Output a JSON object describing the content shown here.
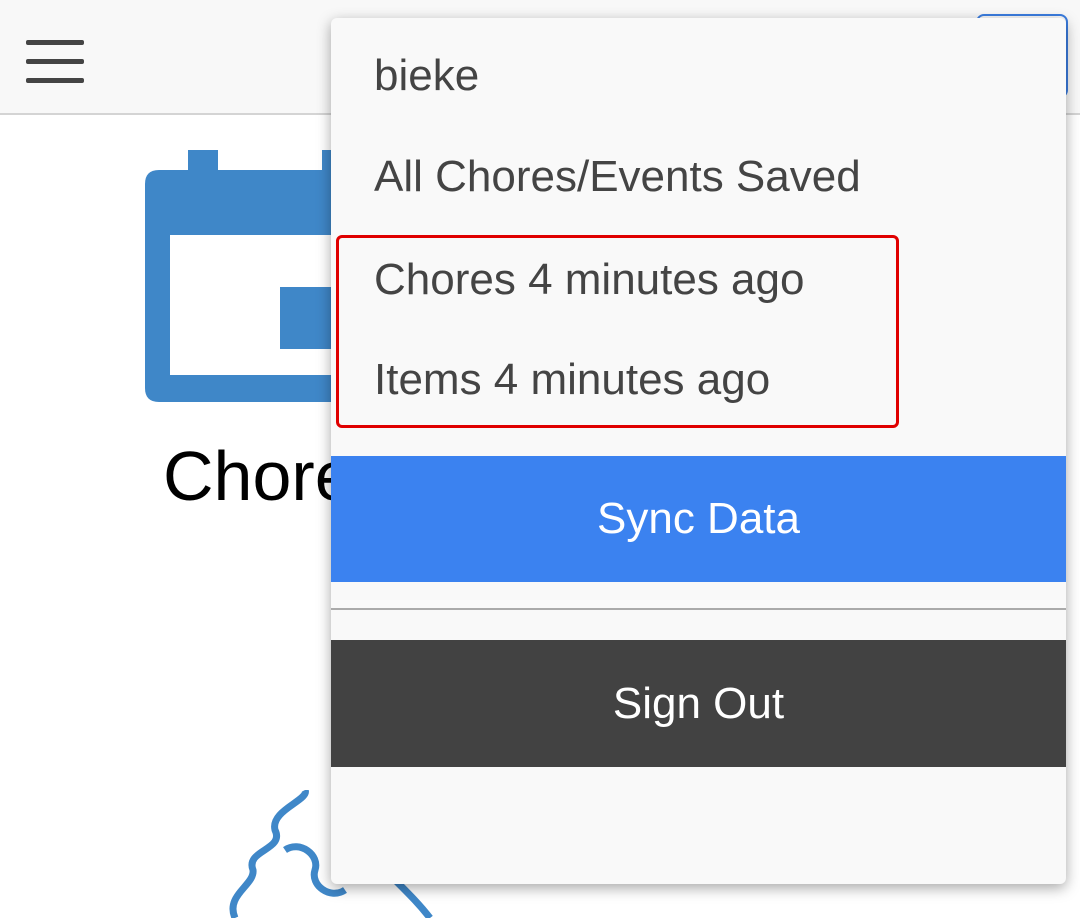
{
  "page": {
    "heading": "Chores"
  },
  "menu": {
    "username": "bieke",
    "save_status": "All Chores/Events Saved",
    "sync_items": [
      "Chores 4 minutes ago",
      "Items 4 minutes ago"
    ],
    "sync_button": "Sync Data",
    "sign_out_button": "Sign Out"
  },
  "colors": {
    "accent": "#3b82f0",
    "icon_blue": "#3f87c8",
    "sign_out_bg": "#424242",
    "highlight": "#e00000"
  },
  "icons": {
    "menu": "hamburger-icon",
    "illustration": "calendar-icon",
    "decoration": "squiggle-icon"
  }
}
